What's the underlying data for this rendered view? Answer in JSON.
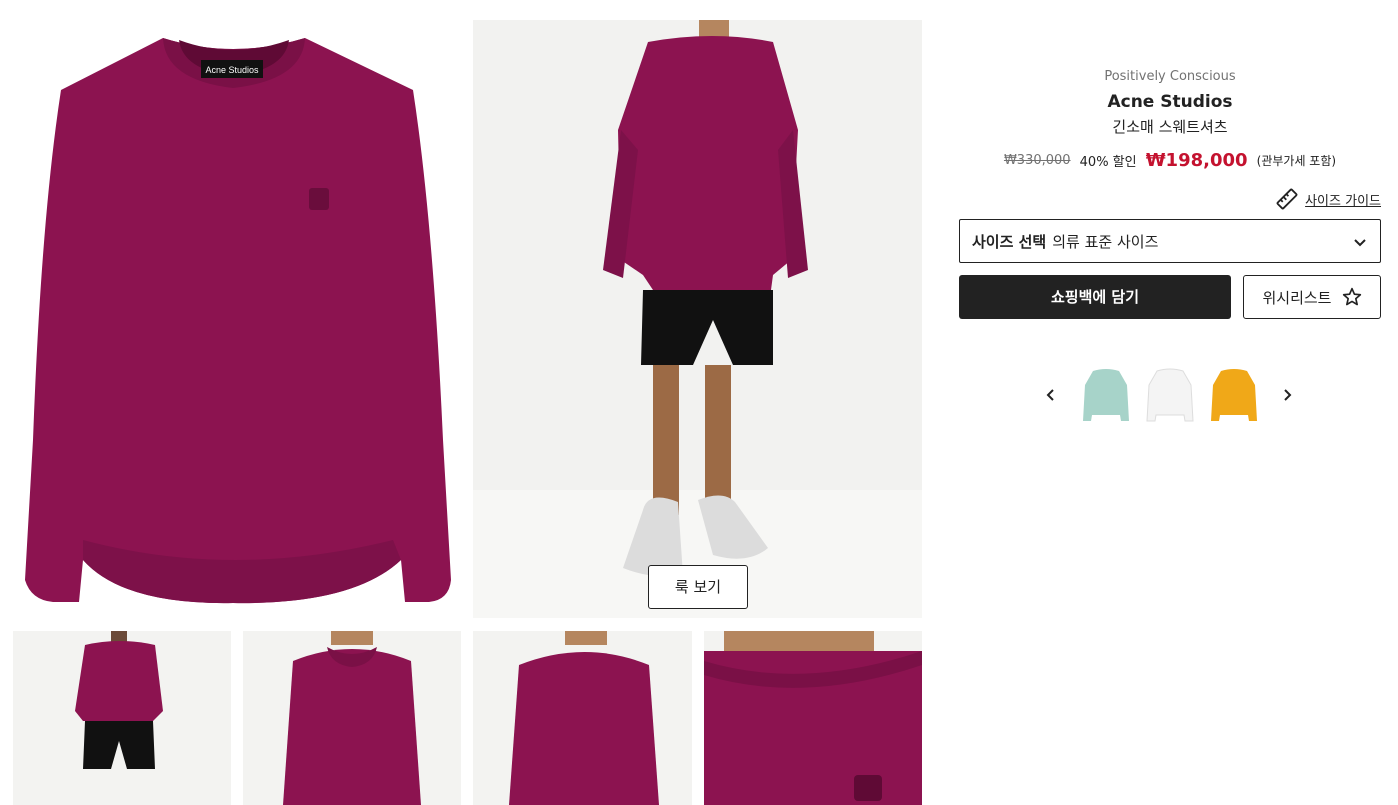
{
  "gallery": {
    "look_button_label": "룩 보기",
    "main_image_label": "Acne Studios"
  },
  "product": {
    "tag": "Positively Conscious",
    "brand": "Acne Studios",
    "name": "긴소매 스웨트셔츠",
    "original_price": "₩330,000",
    "discount": "40% 할인",
    "sale_price": "₩198,000",
    "tax_note": "(관부가세 포함)"
  },
  "size_guide": {
    "label": "사이즈 가이드",
    "icon": "ruler-icon"
  },
  "size_select": {
    "label": "사이즈 선택",
    "value": "의류 표준 사이즈",
    "icon": "chevron-down-icon"
  },
  "actions": {
    "add_to_bag": "쇼핑백에 담기",
    "wishlist": "위시리스트",
    "wishlist_icon": "star-icon"
  },
  "colors": {
    "product": "#8c1350",
    "sale": "#c4122f",
    "button_dark": "#222222",
    "swatches": [
      "#a7d3c9",
      "#f4f4f4",
      "#f0a818"
    ]
  }
}
